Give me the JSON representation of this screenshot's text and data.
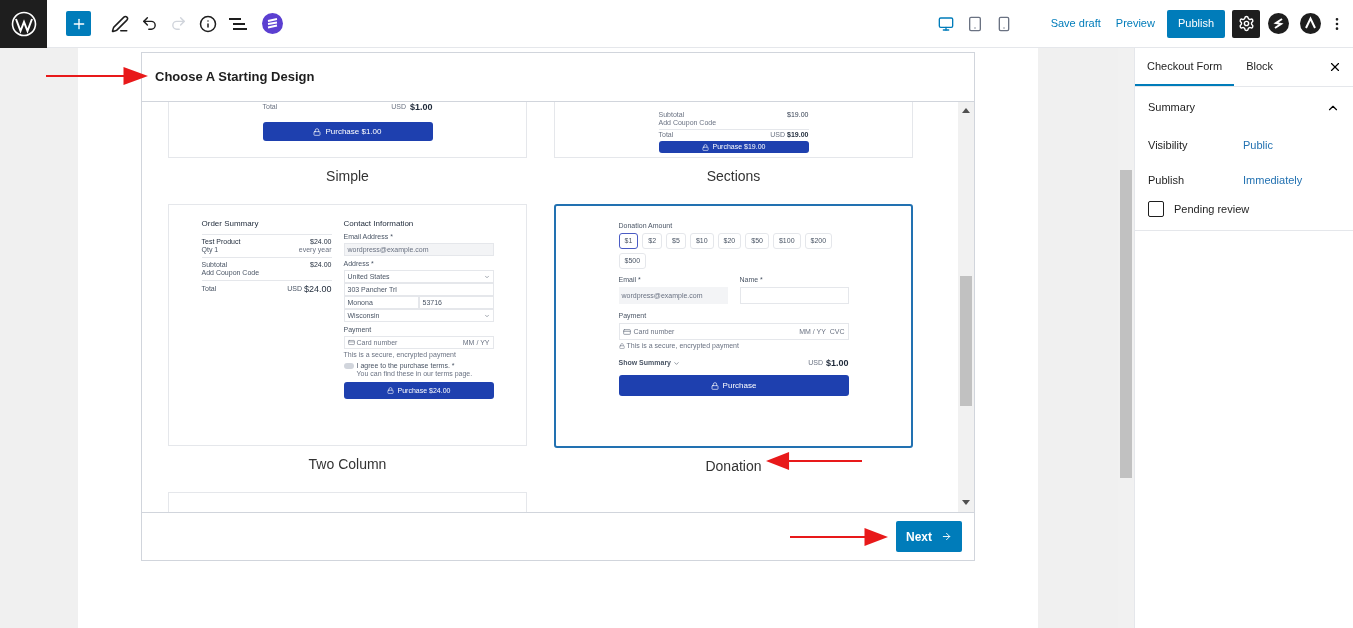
{
  "toolbar": {
    "devices": [
      {
        "kind": "desktop",
        "selected": true
      },
      {
        "kind": "tablet",
        "selected": false
      },
      {
        "kind": "mobile",
        "selected": false
      }
    ],
    "save_draft": "Save draft",
    "preview": "Preview",
    "publish": "Publish"
  },
  "modal": {
    "title": "Choose A Starting Design",
    "designs": [
      {
        "kind": "simple",
        "name": "Simple",
        "selected": false,
        "total_label": "Total",
        "currency": "USD",
        "total": "$1.00",
        "button": "Purchase $1.00"
      },
      {
        "kind": "sections",
        "name": "Sections",
        "selected": false,
        "subtotal_label": "Subtotal",
        "subtotal": "$19.00",
        "coupon": "Add Coupon Code",
        "total_label": "Total",
        "currency": "USD",
        "total": "$19.00",
        "button": "Purchase $19.00"
      },
      {
        "kind": "two_column",
        "name": "Two Column",
        "selected": false,
        "summary_title": "Order Summary",
        "product": "Test Product",
        "product_price": "$24.00",
        "qty": "Qty 1",
        "period": "every year",
        "subtotal_label": "Subtotal",
        "subtotal": "$24.00",
        "coupon": "Add Coupon Code",
        "total_label": "Total",
        "currency": "USD",
        "total": "$24.00",
        "contact_title": "Contact Information",
        "email_label": "Email Address *",
        "email_placeholder": "wordpress@example.com",
        "address_label": "Address *",
        "country": "United States",
        "street": "303 Pancher Trl",
        "city": "Monona",
        "zip": "53716",
        "state": "Wisconsin",
        "payment_label": "Payment",
        "card_placeholder": "Card number",
        "expiry_placeholder": "MM / YY",
        "secure_note": "This is a secure, encrypted payment",
        "terms": "I agree to the purchase terms. *",
        "terms_note": "You can find these in our terms page.",
        "button": "Purchase $24.00"
      },
      {
        "kind": "donation",
        "name": "Donation",
        "selected": true,
        "amount_label": "Donation Amount",
        "amounts": [
          {
            "label": "$1",
            "selected": true
          },
          {
            "label": "$2",
            "selected": false
          },
          {
            "label": "$5",
            "selected": false
          },
          {
            "label": "$10",
            "selected": false
          },
          {
            "label": "$20",
            "selected": false
          },
          {
            "label": "$50",
            "selected": false
          },
          {
            "label": "$100",
            "selected": false
          },
          {
            "label": "$200",
            "selected": false
          },
          {
            "label": "$500",
            "selected": false
          }
        ],
        "email_label": "Email *",
        "email_placeholder": "wordpress@example.com",
        "name_label": "Name *",
        "payment_label": "Payment",
        "card_placeholder": "Card number",
        "expiry_placeholder": "MM / YY  CVC",
        "secure_note": "This is a secure, encrypted payment",
        "summary_toggle": "Show Summary",
        "currency": "USD",
        "total": "$1.00",
        "button": "Purchase"
      },
      {
        "kind": "cut",
        "selected": false
      }
    ],
    "next": "Next"
  },
  "sidebar": {
    "tabs": [
      {
        "label": "Checkout Form",
        "selected": true
      },
      {
        "label": "Block",
        "selected": false
      }
    ],
    "panel": {
      "title": "Summary",
      "expanded": true,
      "rows": [
        {
          "label": "Visibility",
          "value": "Public"
        },
        {
          "label": "Publish",
          "value": "Immediately"
        }
      ],
      "pending_review": {
        "label": "Pending review",
        "checked": false
      }
    }
  }
}
